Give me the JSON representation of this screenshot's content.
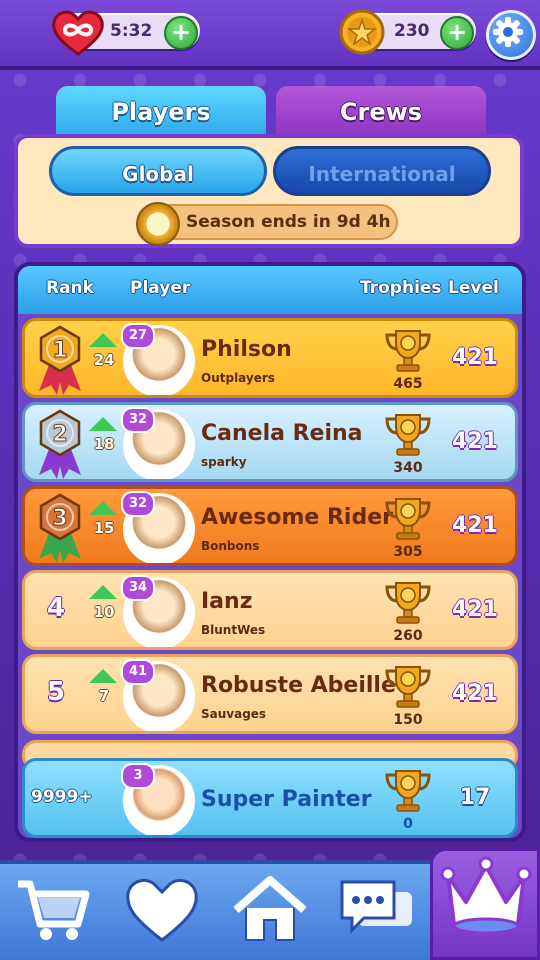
{
  "topbar": {
    "lives_timer": "5:32",
    "coins": "230",
    "lives_icon": "heart-infinity-icon",
    "coin_icon": "star-coin-icon",
    "settings_icon": "gear-icon"
  },
  "tabs": [
    {
      "label": "Players",
      "active": true
    },
    {
      "label": "Crews",
      "active": false
    }
  ],
  "scope": [
    {
      "label": "Global",
      "active": true
    },
    {
      "label": "International",
      "active": false
    }
  ],
  "season": {
    "text": "Season ends in 9d 4h"
  },
  "columns": {
    "rank": "Rank",
    "player": "Player",
    "trophies": "Trophies",
    "level": "Level"
  },
  "rows": [
    {
      "rank": "1",
      "change": "24",
      "badge": "27",
      "name": "Philson",
      "crew": "Outplayers",
      "trophies": "465",
      "level": "421",
      "style": "gold"
    },
    {
      "rank": "2",
      "change": "18",
      "badge": "32",
      "name": "Canela Reina",
      "crew": "sparky",
      "trophies": "340",
      "level": "421",
      "style": "silver"
    },
    {
      "rank": "3",
      "change": "15",
      "badge": "32",
      "name": "Awesome Rider",
      "crew": "Bonbons",
      "trophies": "305",
      "level": "421",
      "style": "bronze"
    },
    {
      "rank": "4",
      "change": "10",
      "badge": "34",
      "name": "Ianz",
      "crew": "BluntWes",
      "trophies": "260",
      "level": "421",
      "style": "plain"
    },
    {
      "rank": "5",
      "change": "7",
      "badge": "41",
      "name": "Robuste Abeille",
      "crew": "Sauvages",
      "trophies": "150",
      "level": "421",
      "style": "plain"
    }
  ],
  "self_row": {
    "rank": "9999+",
    "badge": "3",
    "name": "Super Painter",
    "trophies": "0",
    "level": "17"
  },
  "bottom_nav": [
    {
      "icon": "cart-icon",
      "active": false
    },
    {
      "icon": "heart-icon",
      "active": false
    },
    {
      "icon": "home-icon",
      "active": false
    },
    {
      "icon": "chat-icon",
      "active": false
    },
    {
      "icon": "crown-icon",
      "active": true
    }
  ]
}
